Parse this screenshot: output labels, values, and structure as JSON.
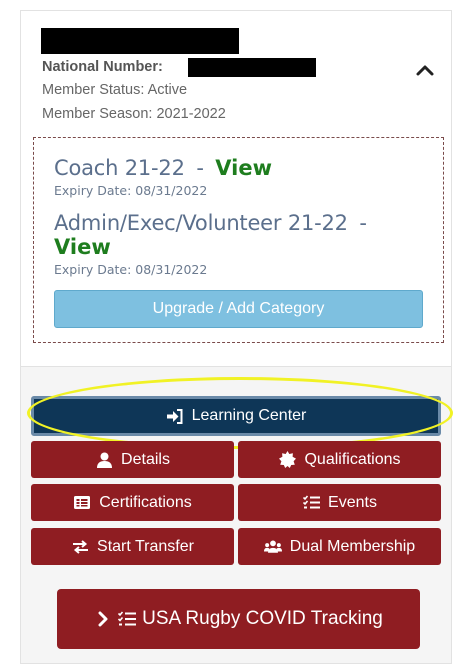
{
  "member": {
    "national_number_label": "National Number:",
    "status": "Member Status: Active",
    "season": "Member Season: 2021-2022"
  },
  "categories": [
    {
      "title": "Coach 21-22",
      "separator": "-",
      "view_label": "View",
      "expiry": "Expiry Date: 08/31/2022"
    },
    {
      "title": "Admin/Exec/Volunteer 21-22",
      "separator": "-",
      "view_label": "View",
      "expiry": "Expiry Date: 08/31/2022"
    }
  ],
  "upgrade_label": "Upgrade / Add Category",
  "actions": {
    "learning_center": "Learning Center",
    "details": "Details",
    "qualifications": "Qualifications",
    "certifications": "Certifications",
    "events": "Events",
    "start_transfer": "Start Transfer",
    "dual_membership": "Dual Membership",
    "covid_tracking": "USA Rugby COVID Tracking"
  },
  "colors": {
    "primary_navy": "#0e3657",
    "action_red": "#8f1d22",
    "view_green": "#1e7d1e",
    "upgrade_blue": "#7ec0e0",
    "highlight_yellow": "#f1f225"
  },
  "icons": {
    "collapse": "chevron-up-icon",
    "learning_center": "sign-in-icon",
    "details": "user-icon",
    "qualifications": "certificate-icon",
    "certifications": "id-card-icon",
    "events": "list-check-icon",
    "start_transfer": "exchange-icon",
    "dual_membership": "users-icon",
    "covid_tracking": "chevron-right-icon"
  }
}
